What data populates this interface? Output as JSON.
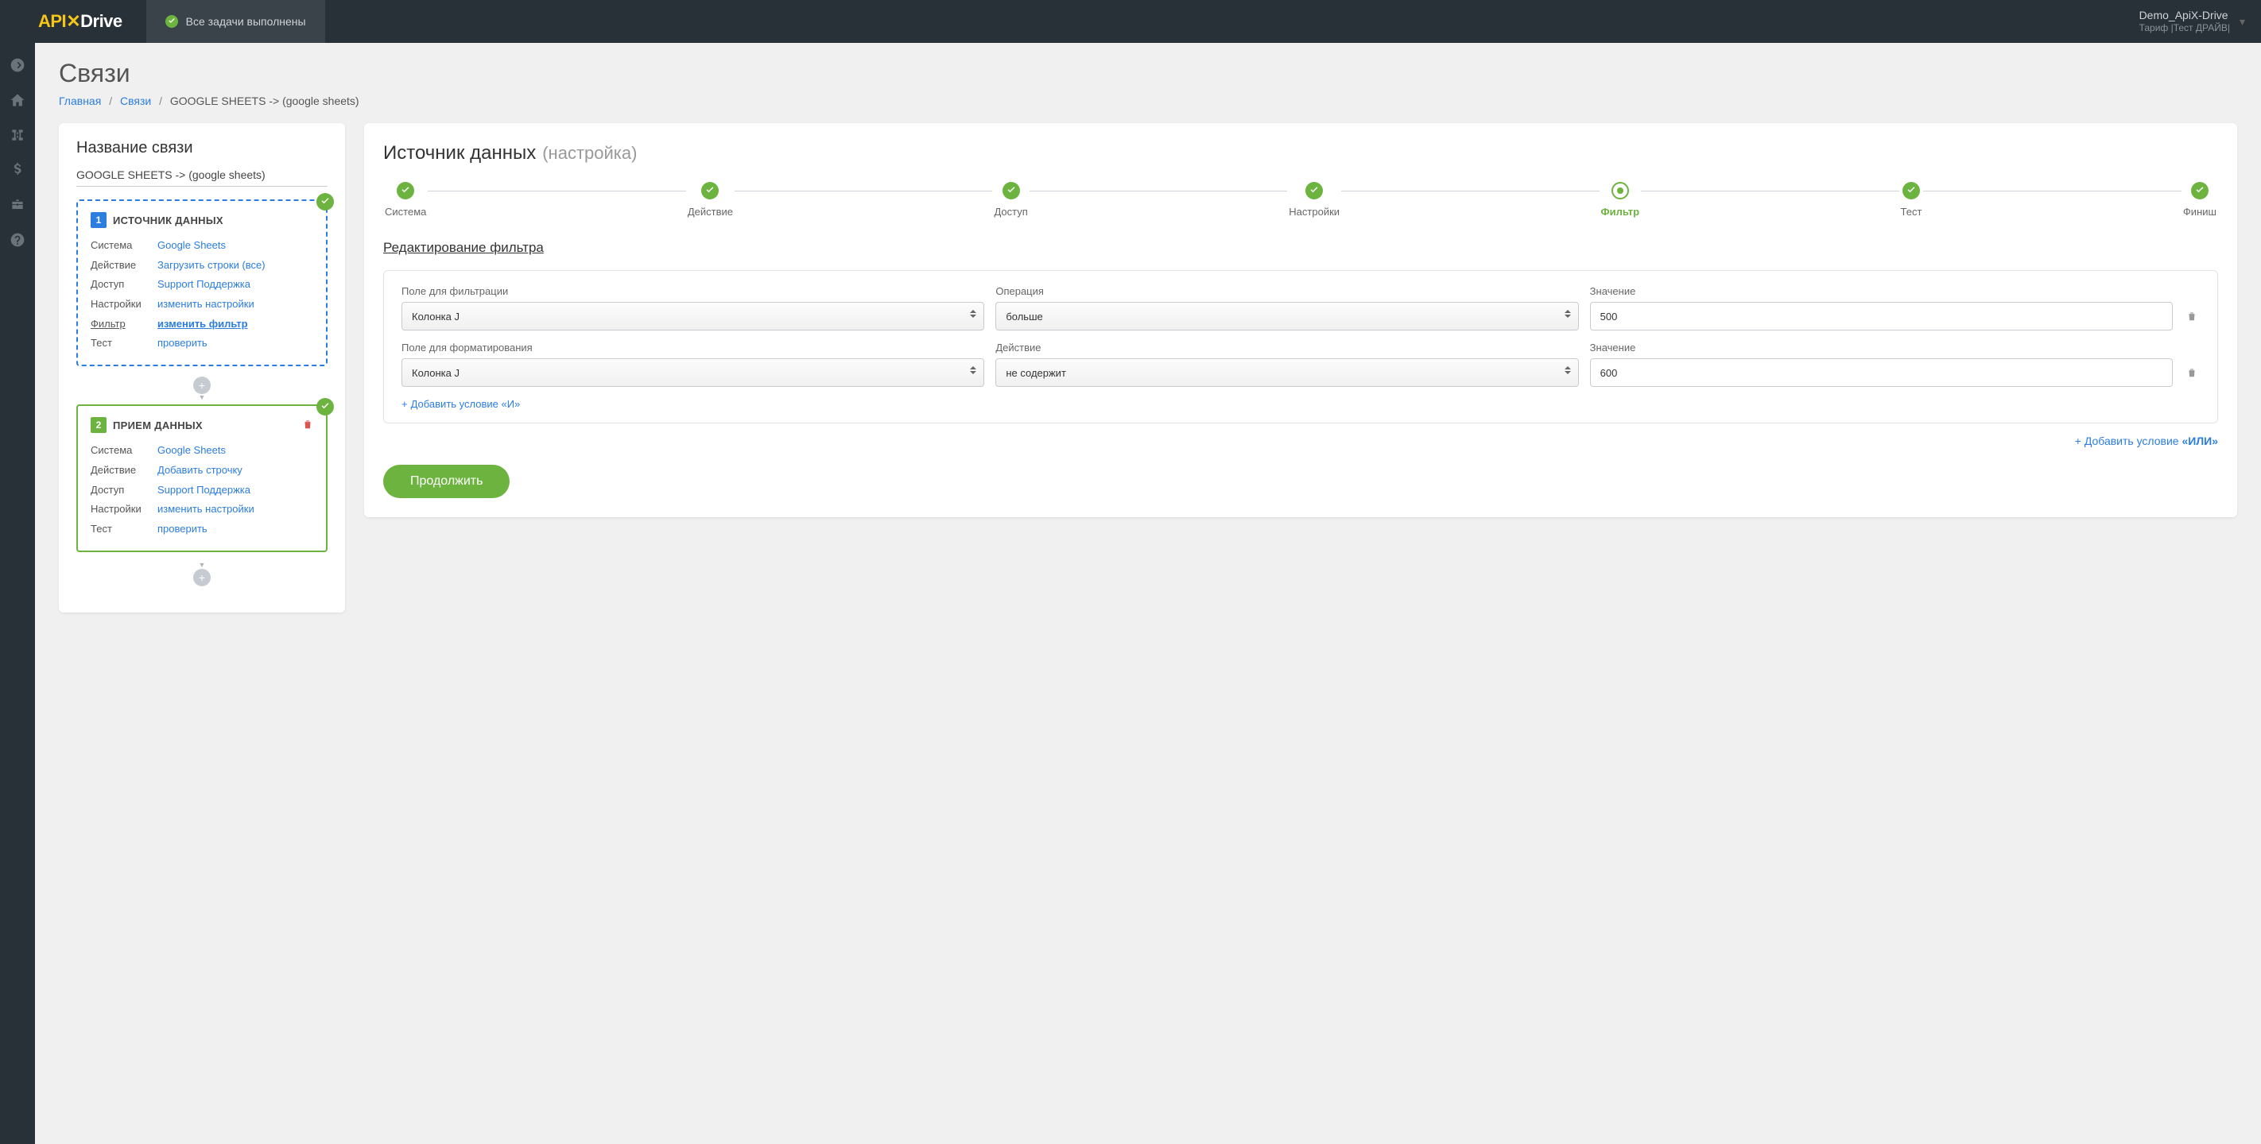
{
  "topbar": {
    "logo_api": "API",
    "logo_drive": "Drive",
    "status": "Все задачи выполнены",
    "account_name": "Demo_ApiX-Drive",
    "account_plan": "Тариф |Тест ДРАЙВ|"
  },
  "page": {
    "title": "Связи"
  },
  "breadcrumb": {
    "home": "Главная",
    "links": "Связи",
    "current": "GOOGLE SHEETS -> (google sheets)"
  },
  "left": {
    "title": "Название связи",
    "conn_name": "GOOGLE SHEETS -> (google sheets)",
    "source": {
      "title": "ИСТОЧНИК ДАННЫХ",
      "num": "1",
      "rows": {
        "system_label": "Система",
        "system_value": "Google Sheets",
        "action_label": "Действие",
        "action_value": "Загрузить строки (все)",
        "access_label": "Доступ",
        "access_value": "Support Поддержка",
        "settings_label": "Настройки",
        "settings_value": "изменить настройки",
        "filter_label": "Фильтр",
        "filter_value": "изменить фильтр",
        "test_label": "Тест",
        "test_value": "проверить"
      }
    },
    "dest": {
      "title": "ПРИЕМ ДАННЫХ",
      "num": "2",
      "rows": {
        "system_label": "Система",
        "system_value": "Google Sheets",
        "action_label": "Действие",
        "action_value": "Добавить строчку",
        "access_label": "Доступ",
        "access_value": "Support Поддержка",
        "settings_label": "Настройки",
        "settings_value": "изменить настройки",
        "test_label": "Тест",
        "test_value": "проверить"
      }
    }
  },
  "right": {
    "title": "Источник данных",
    "subtitle": "(настройка)",
    "steps": {
      "system": "Система",
      "action": "Действие",
      "access": "Доступ",
      "settings": "Настройки",
      "filter": "Фильтр",
      "test": "Тест",
      "finish": "Финиш"
    },
    "filter_title": "Редактирование фильтра",
    "labels": {
      "field_filter": "Поле для фильтрации",
      "operation": "Операция",
      "value": "Значение",
      "field_format": "Поле для форматирования",
      "action": "Действие"
    },
    "rows": [
      {
        "field": "Колонка J",
        "op": "больше",
        "value": "500"
      },
      {
        "field": "Колонка J",
        "op": "не содержит",
        "value": "600"
      }
    ],
    "add_and": "Добавить условие «И»",
    "add_or_prefix": "+ Добавить условие ",
    "add_or_bold": "«ИЛИ»",
    "continue": "Продолжить"
  }
}
